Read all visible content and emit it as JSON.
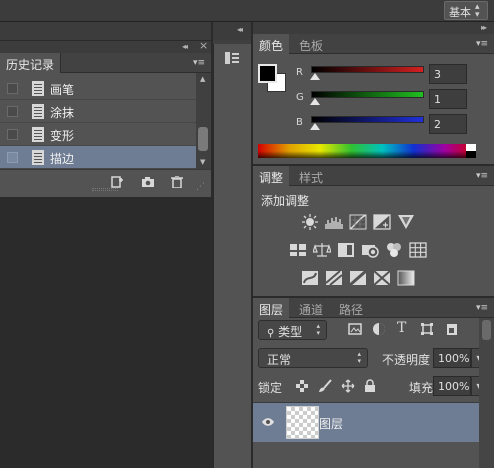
{
  "topbar": {
    "workspace_label": "基本",
    "workspace_arrows": "⬍"
  },
  "history": {
    "tab": "历史记录",
    "collapse": "◂◂",
    "close": "×",
    "menu": "▾≡",
    "items": [
      {
        "label": "画笔",
        "selected": false
      },
      {
        "label": "涂抹",
        "selected": false
      },
      {
        "label": "变形",
        "selected": false
      },
      {
        "label": "描边",
        "selected": true
      }
    ]
  },
  "dock": {
    "collapse": "◂◂"
  },
  "color": {
    "tabs": [
      "颜色",
      "色板"
    ],
    "channels": [
      {
        "name": "R",
        "value": "3",
        "color": "#d42020"
      },
      {
        "name": "G",
        "value": "1",
        "color": "#20c020"
      },
      {
        "name": "B",
        "value": "2",
        "color": "#2030d8"
      }
    ],
    "foreground": "#000000",
    "background": "#ffffff",
    "menu": "▾≡",
    "collapse": "▸▸"
  },
  "adjustments": {
    "tabs": [
      "调整",
      "样式"
    ],
    "title": "添加调整",
    "menu": "▾≡",
    "row1": [
      "brightness-icon",
      "levels-icon",
      "curves-icon",
      "exposure-icon",
      "gradient-triangle-icon"
    ],
    "row2": [
      "vibrance-icon",
      "balance-icon",
      "bw-icon",
      "photo-filter-icon",
      "channel-mixer-icon",
      "color-lookup-icon"
    ],
    "row3": [
      "invert-icon",
      "posterize-icon",
      "threshold-icon",
      "selective-color-icon",
      "gradient-map-icon"
    ]
  },
  "layers": {
    "tabs": [
      "图层",
      "通道",
      "路径"
    ],
    "menu": "▾≡",
    "filter_kind": "类型",
    "blend_mode": "正常",
    "opacity_label": "不透明度",
    "opacity_value": "100%",
    "lock_label": "锁定",
    "fill_label": "填充",
    "fill_value": "100%",
    "layer_name": "图层"
  }
}
